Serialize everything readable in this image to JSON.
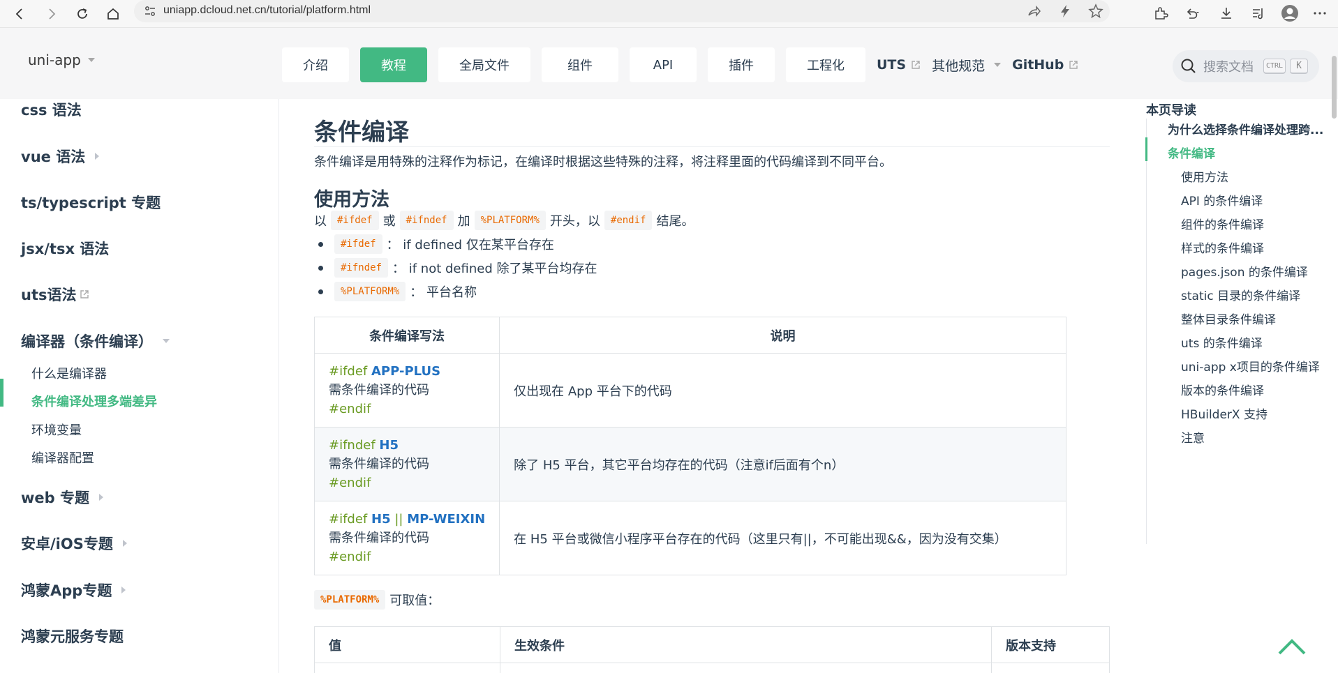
{
  "browser": {
    "url": "uniapp.dcloud.net.cn/tutorial/platform.html"
  },
  "header": {
    "brand": "uni-app",
    "nav": [
      {
        "label": "介绍"
      },
      {
        "label": "教程"
      },
      {
        "label": "全局文件"
      },
      {
        "label": "组件"
      },
      {
        "label": "API"
      },
      {
        "label": "插件"
      },
      {
        "label": "工程化"
      }
    ],
    "links": {
      "uts": "UTS",
      "other": "其他规范",
      "github": "GitHub"
    },
    "search": {
      "placeholder": "搜索文档",
      "key1": "CTRL",
      "key2": "K"
    }
  },
  "sidebar": {
    "sections": [
      {
        "label": "css 语法"
      },
      {
        "label": "vue 语法"
      },
      {
        "label": "ts/typescript 专题"
      },
      {
        "label": "jsx/tsx 语法"
      },
      {
        "label": "uts语法"
      },
      {
        "label": "编译器（条件编译）"
      },
      {
        "label": "web 专题"
      },
      {
        "label": "安卓/iOS专题"
      },
      {
        "label": "鸿蒙App专题"
      },
      {
        "label": "鸿蒙元服务专题"
      }
    ],
    "items": [
      {
        "label": "什么是编译器"
      },
      {
        "label": "条件编译处理多端差异"
      },
      {
        "label": "环境变量"
      },
      {
        "label": "编译器配置"
      }
    ]
  },
  "main": {
    "title": "条件编译",
    "intro": "条件编译是用特殊的注释作为标记，在编译时根据这些特殊的注释，将注释里面的代码编译到不同平台。",
    "usage": {
      "heading": "使用方法",
      "line": {
        "t1": "以",
        "c1": "#ifdef",
        "t2": "或",
        "c2": "#ifndef",
        "t3": "加",
        "c3": "%PLATFORM%",
        "t4": "开头，以",
        "c4": "#endif",
        "t5": "结尾。"
      },
      "bullets": [
        {
          "code": "#ifdef",
          "text": "： if defined 仅在某平台存在"
        },
        {
          "code": "#ifndef",
          "text": "： if not defined 除了某平台均存在"
        },
        {
          "code": "%PLATFORM%",
          "text": "： 平台名称"
        }
      ]
    },
    "table1": {
      "headers": [
        "条件编译写法",
        "说明"
      ],
      "rows": [
        {
          "kw": "#ifdef",
          "p1": "APP-PLUS",
          "sep": "",
          "p2": "",
          "body": "需条件编译的代码",
          "end": "#endif",
          "desc": "仅出现在 App 平台下的代码"
        },
        {
          "kw": "#ifndef",
          "p1": "H5",
          "sep": "",
          "p2": "",
          "body": "需条件编译的代码",
          "end": "#endif",
          "desc": "除了 H5 平台，其它平台均存在的代码（注意if后面有个n）"
        },
        {
          "kw": "#ifdef",
          "p1": "H5",
          "sep": "||",
          "p2": "MP-WEIXIN",
          "body": "需条件编译的代码",
          "end": "#endif",
          "desc": "在 H5 平台或微信小程序平台存在的代码（这里只有||，不可能出现&&，因为没有交集）"
        }
      ]
    },
    "platform_note": {
      "code": "%PLATFORM%",
      "text": "可取值："
    },
    "table2": {
      "headers": [
        "值",
        "生效条件",
        "版本支持"
      ]
    }
  },
  "toc": {
    "title": "本页导读",
    "items": [
      {
        "label": "为什么选择条件编译处理跨..."
      },
      {
        "label": "条件编译"
      },
      {
        "label": "使用方法"
      },
      {
        "label": "API 的条件编译"
      },
      {
        "label": "组件的条件编译"
      },
      {
        "label": "样式的条件编译"
      },
      {
        "label": "pages.json 的条件编译"
      },
      {
        "label": "static 目录的条件编译"
      },
      {
        "label": "整体目录条件编译"
      },
      {
        "label": "uts 的条件编译"
      },
      {
        "label": "uni-app x项目的条件编译"
      },
      {
        "label": "版本的条件编译"
      },
      {
        "label": "HBuilderX 支持"
      },
      {
        "label": "注意"
      }
    ]
  },
  "colors": {
    "accent": "#42b983",
    "code": "#e96900",
    "keyword": "#6a9b23",
    "platform": "#2271c1"
  }
}
